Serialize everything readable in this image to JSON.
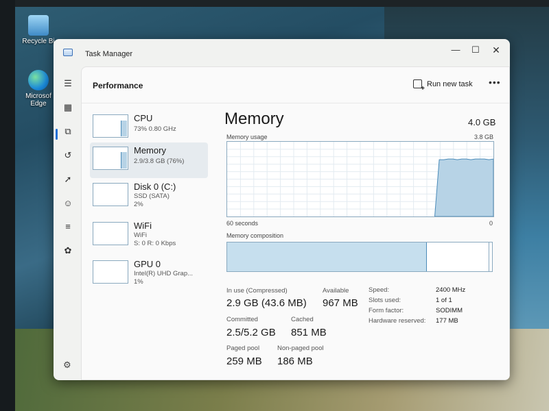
{
  "desktop": {
    "icons": [
      {
        "label": "Recycle Bi"
      },
      {
        "label": "Microsof Edge"
      }
    ]
  },
  "window": {
    "title": "Task Manager",
    "controls": {
      "minimize": "—",
      "maximize": "☐",
      "close": "✕"
    }
  },
  "nav": {
    "items": [
      {
        "icon": "hamburger-menu-icon",
        "glyph": "☰"
      },
      {
        "icon": "processes-icon",
        "glyph": "▦"
      },
      {
        "icon": "performance-icon",
        "glyph": "⧉",
        "active": true
      },
      {
        "icon": "app-history-icon",
        "glyph": "↺"
      },
      {
        "icon": "startup-apps-icon",
        "glyph": "➚"
      },
      {
        "icon": "users-icon",
        "glyph": "☺"
      },
      {
        "icon": "details-icon",
        "glyph": "≡"
      },
      {
        "icon": "services-icon",
        "glyph": "✿"
      }
    ],
    "settings_icon": "settings-gear-icon",
    "settings_glyph": "⚙"
  },
  "header": {
    "title": "Performance",
    "run_new_task": "Run new task",
    "more": "•••"
  },
  "resources": [
    {
      "name": "CPU",
      "sub1": "73%  0.80 GHz",
      "sub2": "",
      "level": 0.73
    },
    {
      "name": "Memory",
      "sub1": "2.9/3.8 GB (76%)",
      "sub2": "",
      "level": 0.76,
      "selected": true
    },
    {
      "name": "Disk 0 (C:)",
      "sub1": "SSD (SATA)",
      "sub2": "2%",
      "level": 0.02
    },
    {
      "name": "WiFi",
      "sub1": "WiFi",
      "sub2": "S: 0  R: 0 Kbps",
      "level": 0.0
    },
    {
      "name": "GPU 0",
      "sub1": "Intel(R) UHD Grap...",
      "sub2": "1%",
      "level": 0.01
    }
  ],
  "detail": {
    "title": "Memory",
    "total": "4.0 GB",
    "usage_label": "Memory usage",
    "usage_max": "3.8 GB",
    "time_left": "60 seconds",
    "time_right": "0",
    "composition_label": "Memory composition",
    "usage_history": [
      0,
      0,
      0,
      0,
      0,
      0,
      0,
      0,
      0,
      0,
      0,
      0,
      0,
      0,
      0,
      0,
      0,
      0,
      0,
      0,
      0,
      0,
      0,
      0,
      0,
      0,
      0,
      0,
      0,
      0,
      0,
      0,
      0,
      0,
      0,
      0,
      0,
      0,
      0,
      0,
      0,
      0,
      0,
      0,
      0,
      0,
      0,
      0.76,
      0.76,
      0.77,
      0.77,
      0.76,
      0.77,
      0.77,
      0.76,
      0.77,
      0.77,
      0.77,
      0.76,
      0.77
    ],
    "composition": {
      "in_use": 0.755,
      "standby_end": 0.99
    },
    "stats": [
      {
        "label": "In use (Compressed)",
        "value": "2.9 GB (43.6 MB)"
      },
      {
        "label": "Available",
        "value": "967 MB"
      },
      {
        "label": "Committed",
        "value": "2.5/5.2 GB"
      },
      {
        "label": "Cached",
        "value": "851 MB"
      },
      {
        "label": "Paged pool",
        "value": "259 MB"
      },
      {
        "label": "Non-paged pool",
        "value": "186 MB"
      }
    ],
    "specs": [
      {
        "label": "Speed:",
        "value": "2400 MHz"
      },
      {
        "label": "Slots used:",
        "value": "1 of 1"
      },
      {
        "label": "Form factor:",
        "value": "SODIMM"
      },
      {
        "label": "Hardware reserved:",
        "value": "177 MB"
      }
    ]
  },
  "colors": {
    "accent": "#1f6fd6",
    "graph_fill": "#b7d3e6",
    "graph_line": "#4b8bb9",
    "graph_border": "#8aa9bf"
  }
}
